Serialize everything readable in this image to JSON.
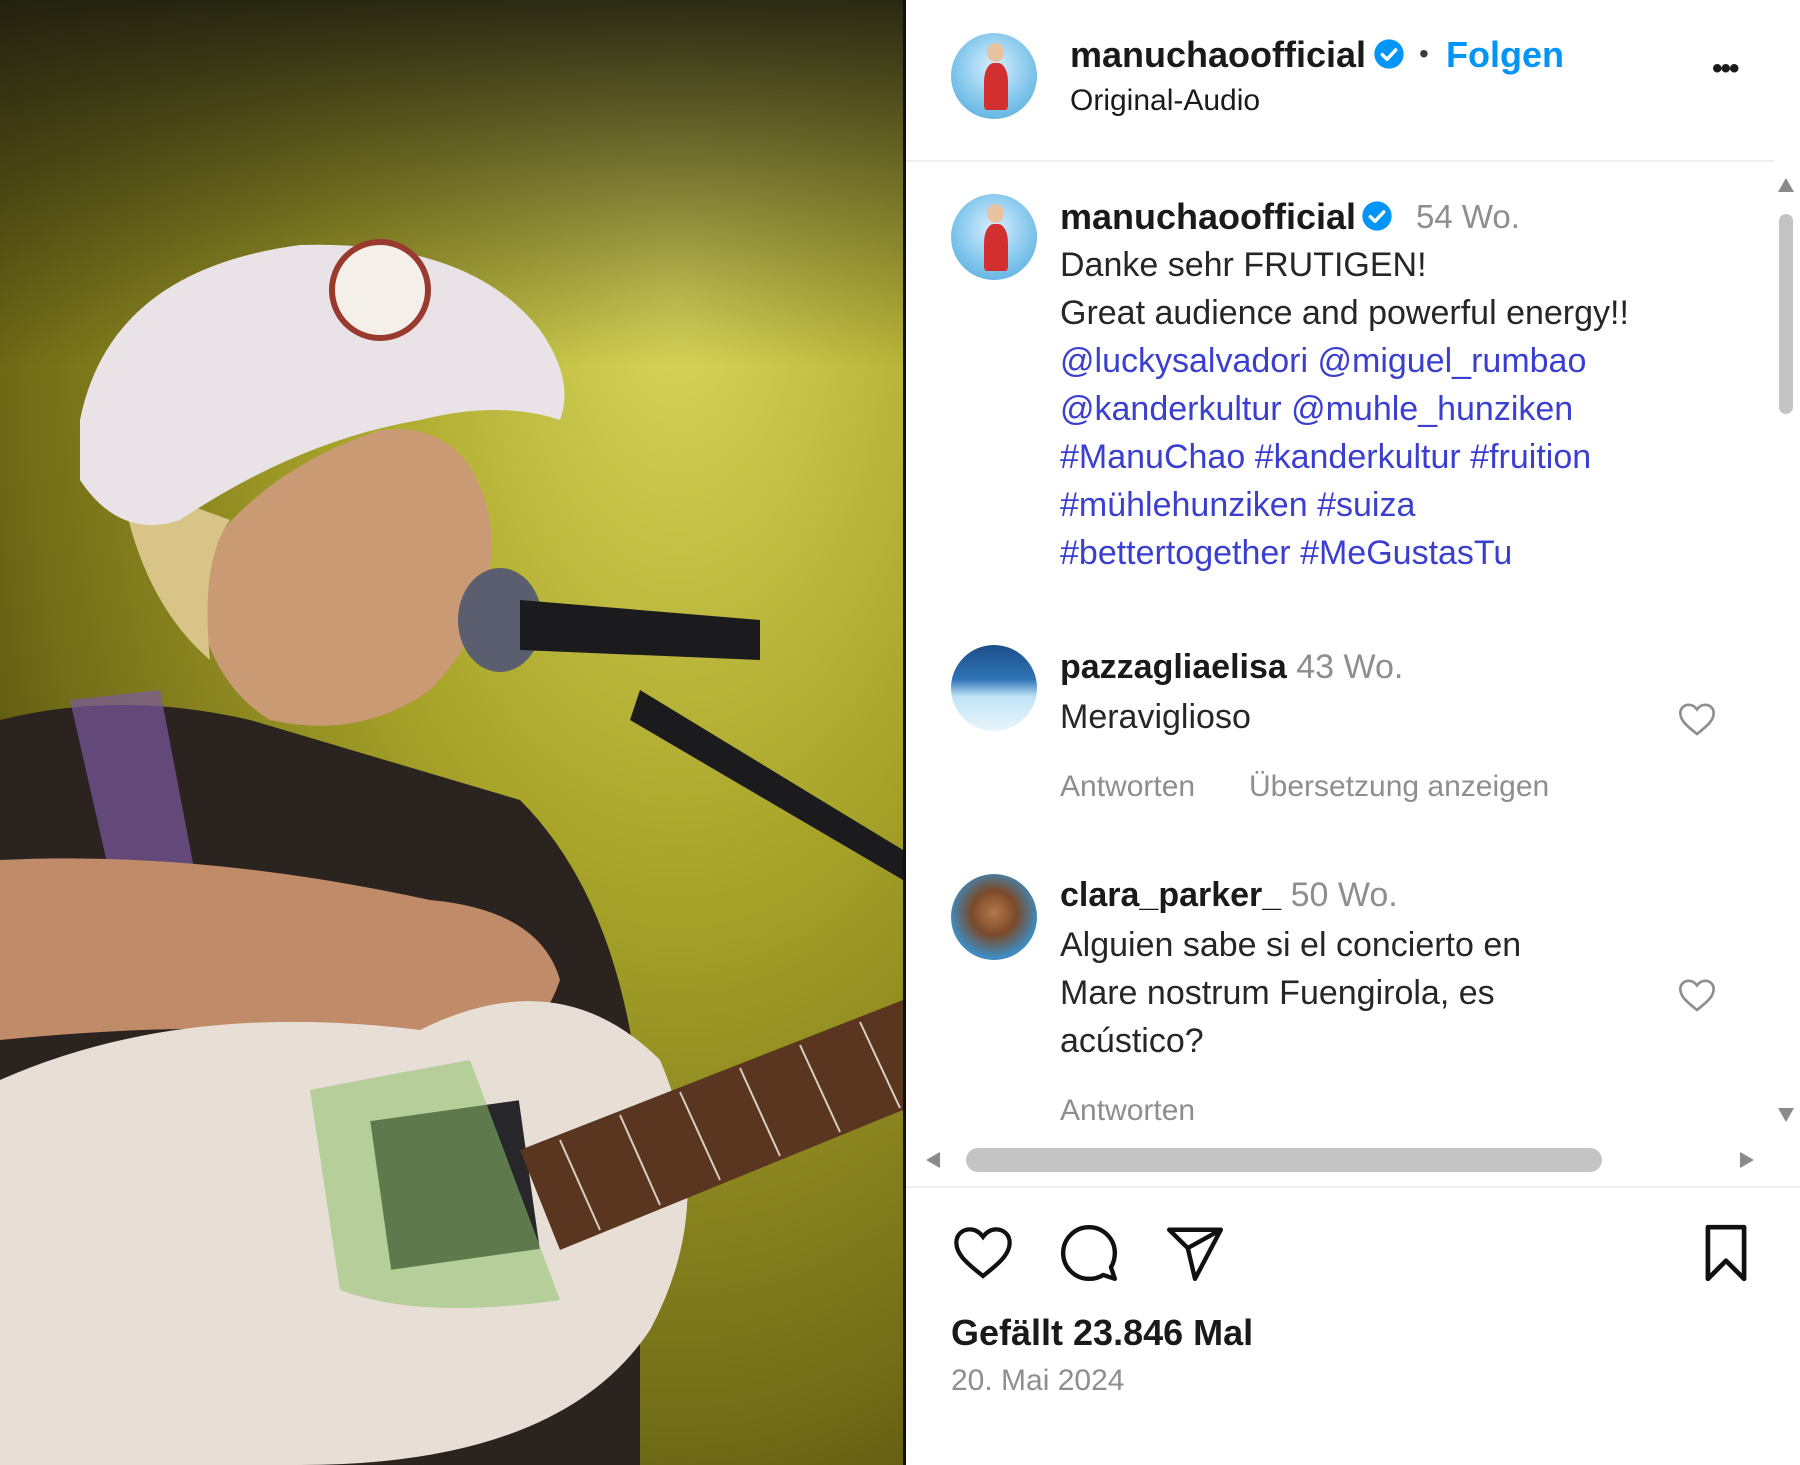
{
  "header": {
    "username": "manuchaoofficial",
    "dot": "•",
    "follow_label": "Folgen",
    "subtitle": "Original-Audio",
    "more": "•••"
  },
  "caption": {
    "username": "manuchaoofficial",
    "time": "54 Wo.",
    "line1": "Danke sehr FRUTIGEN!",
    "line2": "Great audience and powerful energy!!",
    "mentions1": [
      "@luckysalvadori",
      "@miguel_rumbao"
    ],
    "mentions2": [
      "@kanderkultur",
      "@muhle_hunziken"
    ],
    "tags1": [
      "#ManuChao",
      "#kanderkultur",
      "#fruition"
    ],
    "tags2": [
      "#mühlehunziken",
      "#suiza"
    ],
    "tags3": [
      "#bettertogether",
      "#MeGustasTu"
    ]
  },
  "comments": [
    {
      "username": "pazzagliaelisa",
      "time": "43 Wo.",
      "text": "Meraviglioso",
      "reply": "Antworten",
      "translate": "Übersetzung anzeigen"
    },
    {
      "username": "clara_parker_",
      "time": "50 Wo.",
      "text_lines": [
        "Alguien sabe si el concierto en",
        "Mare nostrum Fuengirola, es",
        "acústico?"
      ],
      "reply": "Antworten"
    }
  ],
  "footer": {
    "likes": "Gefällt 23.846 Mal",
    "date": "20. Mai 2024"
  },
  "icons": [
    "heart-icon",
    "comment-icon",
    "share-icon",
    "bookmark-icon",
    "verified-icon",
    "more-icon",
    "like-comment-icon"
  ],
  "colors": {
    "accent": "#0095f6",
    "link": "#3b3fd0",
    "muted": "#8e8e8e",
    "verified": "#0095f6"
  }
}
